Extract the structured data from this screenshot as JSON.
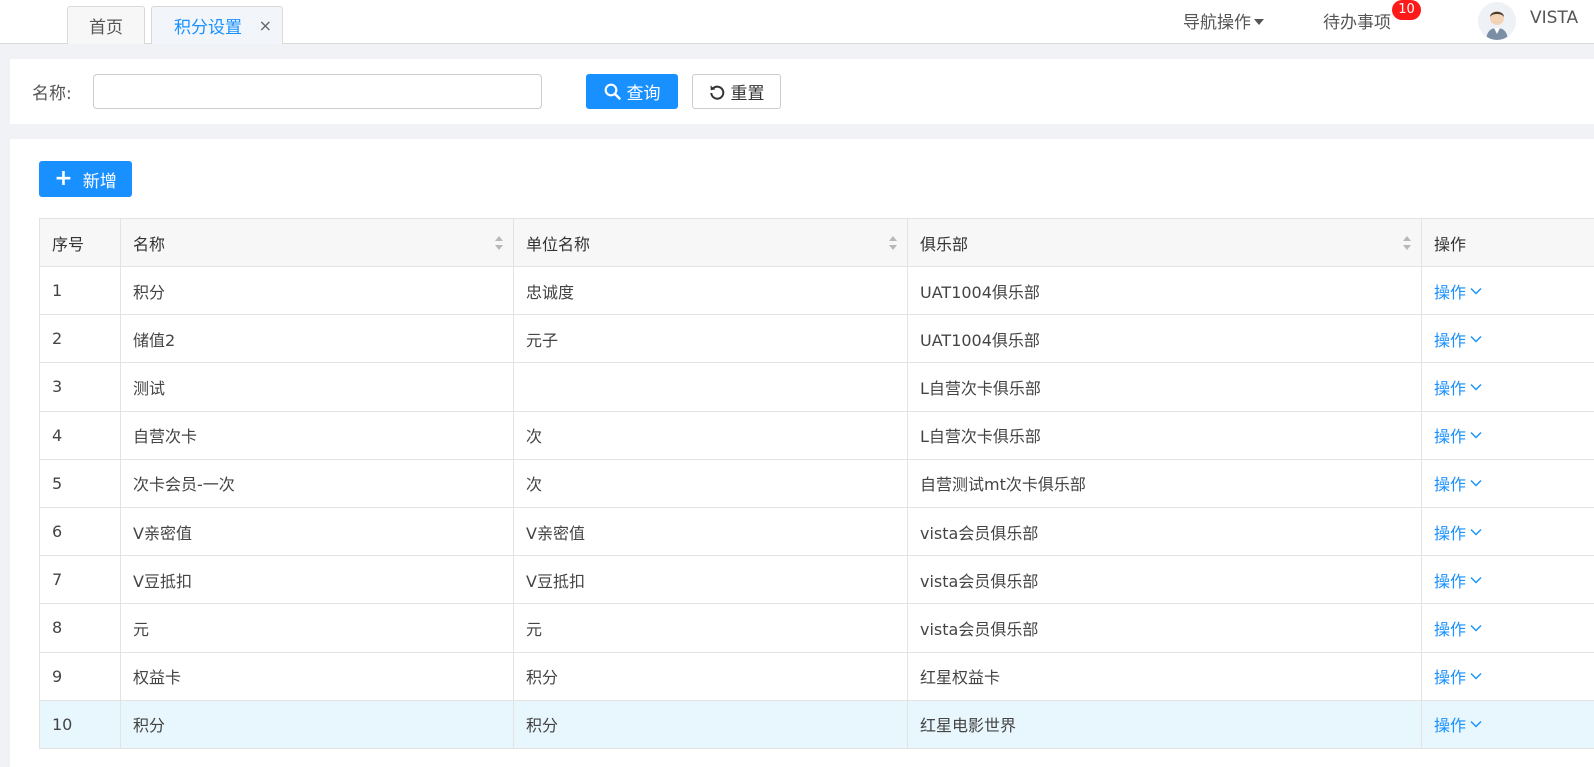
{
  "tabs": [
    {
      "label": "首页"
    },
    {
      "label": "积分设置",
      "close": "×"
    }
  ],
  "header": {
    "nav_menu": "导航操作",
    "todo": "待办事项",
    "todo_count": "10",
    "username": "VISTA"
  },
  "search": {
    "name_label": "名称:",
    "name_value": "",
    "name_placeholder": "",
    "query_label": "查询",
    "reset_label": "重置"
  },
  "toolbar": {
    "add_label": "新增"
  },
  "table": {
    "columns": [
      "序号",
      "名称",
      "单位名称",
      "俱乐部",
      "操作"
    ],
    "action_label": "操作",
    "rows": [
      {
        "idx": "1",
        "name": "积分",
        "unit": "忠诚度",
        "club": "UAT1004俱乐部"
      },
      {
        "idx": "2",
        "name": "储值2",
        "unit": "元子",
        "club": "UAT1004俱乐部"
      },
      {
        "idx": "3",
        "name": "测试",
        "unit": "",
        "club": "L自营次卡俱乐部"
      },
      {
        "idx": "4",
        "name": "自营次卡",
        "unit": "次",
        "club": "L自营次卡俱乐部"
      },
      {
        "idx": "5",
        "name": "次卡会员-一次",
        "unit": "次",
        "club": "自营测试mt次卡俱乐部"
      },
      {
        "idx": "6",
        "name": "V亲密值",
        "unit": "V亲密值",
        "club": "vista会员俱乐部"
      },
      {
        "idx": "7",
        "name": "V豆抵扣",
        "unit": "V豆抵扣",
        "club": "vista会员俱乐部"
      },
      {
        "idx": "8",
        "name": "元",
        "unit": "元",
        "club": "vista会员俱乐部"
      },
      {
        "idx": "9",
        "name": "权益卡",
        "unit": "积分",
        "club": "红星权益卡"
      },
      {
        "idx": "10",
        "name": "积分",
        "unit": "积分",
        "club": "红星电影世界"
      }
    ]
  },
  "colors": {
    "primary": "#1890ff",
    "badge": "#ff1a1a",
    "row_highlight": "#e8f6fd"
  }
}
